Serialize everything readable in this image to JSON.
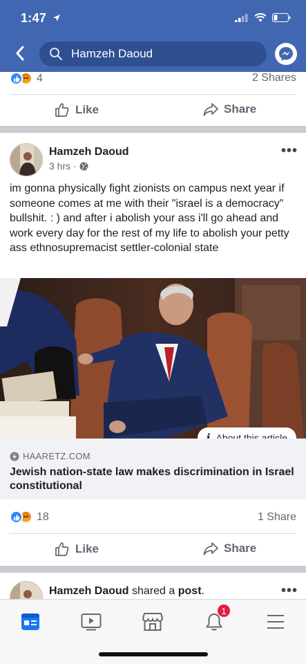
{
  "status_bar": {
    "time": "1:47"
  },
  "header": {
    "search_value": "Hamzeh Daoud"
  },
  "top_post_footer": {
    "reaction_count": "4",
    "shares": "2 Shares"
  },
  "actions": {
    "like_label": "Like",
    "share_label": "Share"
  },
  "post": {
    "author": "Hamzeh Daoud",
    "time": "3 hrs",
    "separator": "·",
    "text": "im gonna physically fight zionists on campus next year if someone comes at me with their \"israel is a democracy\" bullshit. : ) and after i abolish your ass i'll go ahead and work every day for the rest of my life to abolish your petty ass ethnosupremacist settler-colonial state",
    "link": {
      "about_label": "About this article",
      "domain": "HAARETZ.COM",
      "title": "Jewish nation-state law makes discrimination in Israel constitutional"
    },
    "reaction_count": "18",
    "shares": "1 Share"
  },
  "next_post": {
    "author": "Hamzeh Daoud",
    "verb": "shared a",
    "object": "post",
    "punct": "."
  },
  "bottom_nav": {
    "items": [
      {
        "icon": "news-feed-icon",
        "active": true
      },
      {
        "icon": "watch-icon"
      },
      {
        "icon": "marketplace-icon"
      },
      {
        "icon": "notifications-icon",
        "badge": "1"
      },
      {
        "icon": "menu-icon"
      }
    ]
  },
  "colors": {
    "brand": "#4267b2",
    "active_nav": "#1877f2",
    "badge": "#e41e3f"
  }
}
